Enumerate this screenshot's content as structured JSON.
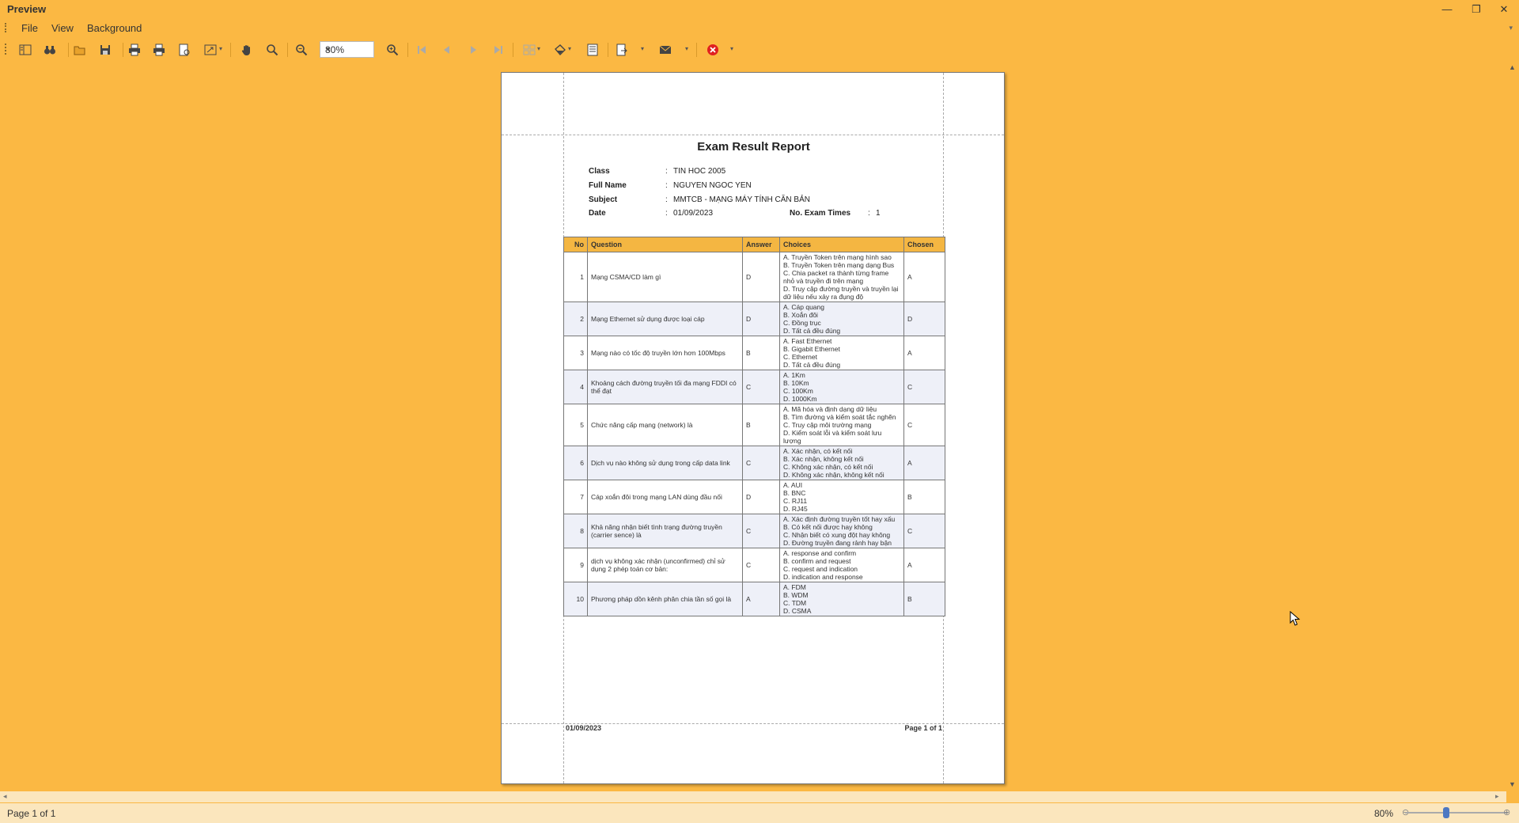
{
  "window": {
    "title": "Preview",
    "controls": [
      "—",
      "❐",
      "✕"
    ]
  },
  "menu": {
    "items": [
      "File",
      "View",
      "Background"
    ]
  },
  "toolbar": {
    "zoom_value": "80%"
  },
  "report": {
    "title": "Exam Result Report",
    "fields": [
      {
        "label": "Class",
        "value": "TIN HOC 2005"
      },
      {
        "label": "Full Name",
        "value": "NGUYEN NGOC  YEN"
      },
      {
        "label": "Subject",
        "value": "MMTCB - MẠNG MÁY TÍNH CĂN BẢN"
      },
      {
        "label": "Date",
        "value": "01/09/2023"
      }
    ],
    "exam_times": {
      "label": "No. Exam Times",
      "value": "1"
    },
    "columns": [
      "No",
      "Question",
      "Answer",
      "Choices",
      "Chosen"
    ],
    "rows": [
      {
        "no": "1",
        "question": "Mạng CSMA/CD làm gì",
        "answer": "D",
        "choices": [
          "A. Truyền Token trên mạng hình sao",
          "B. Truyền Token trên mạng dạng Bus",
          "C. Chia packet ra thành từng frame nhỏ và truyền đi trên mạng",
          "D. Truy cập đường truyền và truyền lại dữ liệu nếu xảy ra đụng độ"
        ],
        "chosen": "A"
      },
      {
        "no": "2",
        "question": "Mạng Ethernet sử dụng được loại cáp",
        "answer": "D",
        "choices": [
          "A. Cáp quang",
          "B. Xoắn đôi",
          "C. Đồng trục",
          "D. Tất cả đều đúng"
        ],
        "chosen": "D"
      },
      {
        "no": "3",
        "question": "Mạng nào có tốc độ truyền lớn hơn 100Mbps",
        "answer": "B",
        "choices": [
          "A. Fast Ethernet",
          "B. Gigabit Ethernet",
          "C. Ethernet",
          "D. Tất cả đều đúng"
        ],
        "chosen": "A"
      },
      {
        "no": "4",
        "question": "Khoảng cách đường truyền tối đa mạng FDDI có thể đạt",
        "answer": "C",
        "choices": [
          "A. 1Km",
          "B. 10Km",
          "C. 100Km",
          "D. 1000Km"
        ],
        "chosen": "C"
      },
      {
        "no": "5",
        "question": "Chức năng cấp mạng (network) là",
        "answer": "B",
        "choices": [
          "A. Mã hóa và định dạng dữ liệu",
          "B. Tìm đường và kiểm soát tắc nghẽn",
          "C. Truy cập môi trường mạng",
          "D. Kiểm soát lỗi và kiểm soát lưu lượng"
        ],
        "chosen": "C"
      },
      {
        "no": "6",
        "question": "Dịch vụ nào không sử dụng trong cấp data link",
        "answer": "C",
        "choices": [
          "A. Xác nhận, có kết nối",
          "B. Xác nhận, không kết nối",
          "C. Không xác nhận, có kết nối",
          "D. Không xác nhận, không kết nối"
        ],
        "chosen": "A"
      },
      {
        "no": "7",
        "question": "Cáp xoắn đôi trong mạng LAN dùng đầu nối",
        "answer": "D",
        "choices": [
          "A. AUI",
          "B. BNC",
          "C. RJ11",
          "D. RJ45"
        ],
        "chosen": "B"
      },
      {
        "no": "8",
        "question": "Khả năng nhận biết tình trạng đường truyền (carrier sence) là",
        "answer": "C",
        "choices": [
          "A. Xác định đường truyền tốt hay xấu",
          "B. Có kết nối được hay không",
          "C. Nhận biết có xung đột hay không",
          "D. Đường truyền đang rảnh hay bận"
        ],
        "chosen": "C"
      },
      {
        "no": "9",
        "question": "dịch vụ không xác nhận (unconfirmed) chỉ sử dụng 2 phép toán cơ bản:",
        "answer": "C",
        "choices": [
          "A. response and confirm",
          "B. confirm and request",
          "C. request and indication",
          "D. indication and response"
        ],
        "chosen": "A"
      },
      {
        "no": "10",
        "question": "Phương pháp dồn kênh phân chia tần số gọi là",
        "answer": "A",
        "choices": [
          "A. FDM",
          "B. WDM",
          "C. TDM",
          "D. CSMA"
        ],
        "chosen": "B"
      }
    ],
    "footer_date": "01/09/2023",
    "footer_page": "Page 1 of 1"
  },
  "status": {
    "page_info": "Page 1 of 1",
    "zoom": "80%",
    "zoom_slider_fraction": 0.4
  }
}
